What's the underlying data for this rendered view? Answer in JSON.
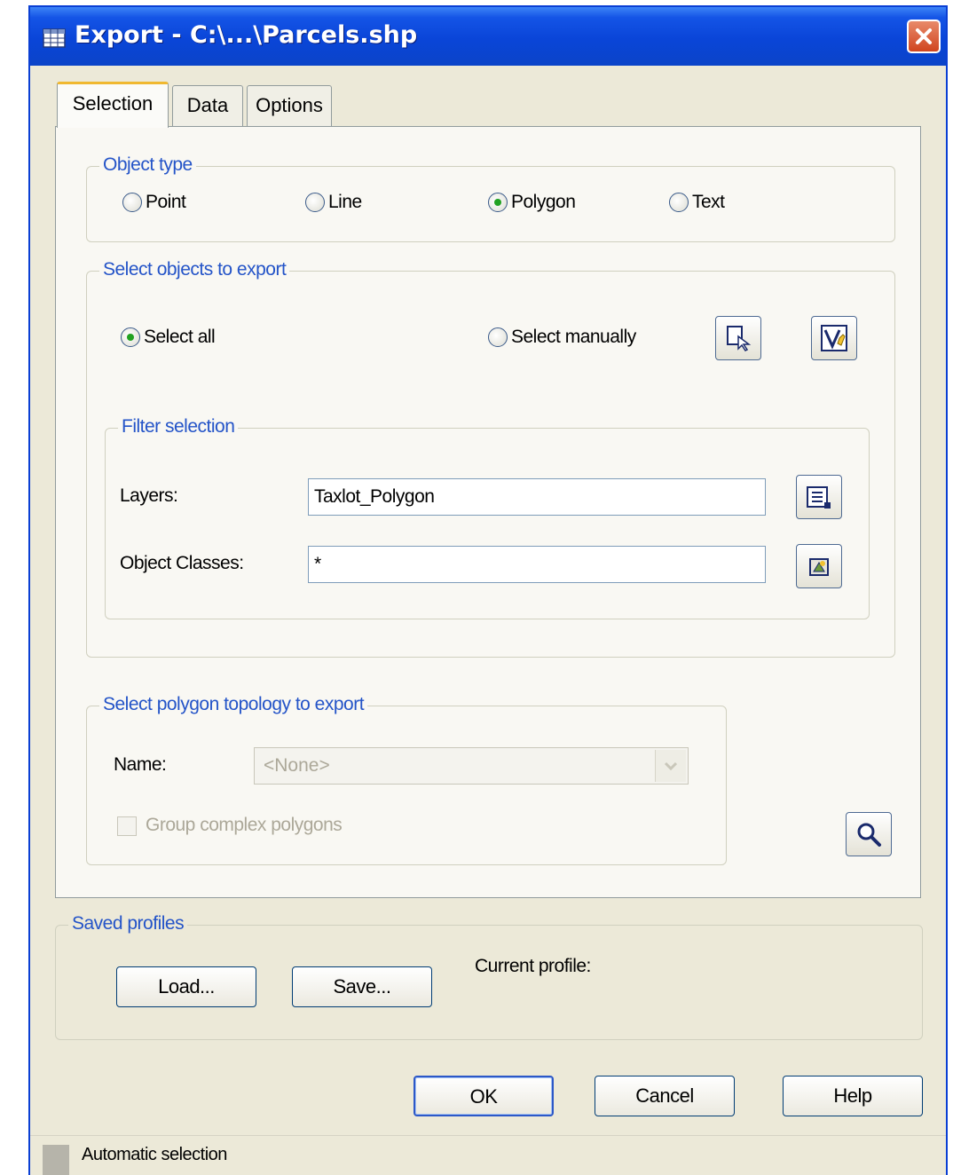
{
  "window": {
    "title": "Export - C:\\...\\Parcels.shp",
    "accent_color": "#0a45d8",
    "icons": {
      "app": "table-icon",
      "close": "close-icon"
    }
  },
  "tabs": [
    {
      "label": "Selection",
      "active": true
    },
    {
      "label": "Data",
      "active": false
    },
    {
      "label": "Options",
      "active": false
    }
  ],
  "object_type": {
    "legend": "Object type",
    "options": [
      {
        "label": "Point",
        "selected": false
      },
      {
        "label": "Line",
        "selected": false
      },
      {
        "label": "Polygon",
        "selected": true
      },
      {
        "label": "Text",
        "selected": false
      }
    ]
  },
  "select_objects": {
    "legend": "Select objects to export",
    "select_all": "Select all",
    "select_manually": "Select manually",
    "selected_mode": "Select all",
    "icons": {
      "pick": "select-objects-icon",
      "filter": "quick-select-filter-icon"
    }
  },
  "filter_selection": {
    "legend": "Filter selection",
    "layers_label": "Layers:",
    "layers_value": "Taxlot_Polygon",
    "classes_label": "Object Classes:",
    "classes_value": "*",
    "icons": {
      "layers": "layer-list-icon",
      "classes": "object-class-icon"
    }
  },
  "topology": {
    "legend": "Select polygon topology to export",
    "name_label": "Name:",
    "name_value": "<None>",
    "group_label": "Group complex polygons",
    "group_checked": false,
    "enabled": false,
    "icons": {
      "zoom": "magnifier-icon"
    }
  },
  "saved_profiles": {
    "legend": "Saved profiles",
    "load": "Load...",
    "save": "Save...",
    "current_label": "Current profile:"
  },
  "buttons": {
    "ok": "OK",
    "cancel": "Cancel",
    "help": "Help"
  },
  "status": {
    "text": "Automatic selection"
  }
}
